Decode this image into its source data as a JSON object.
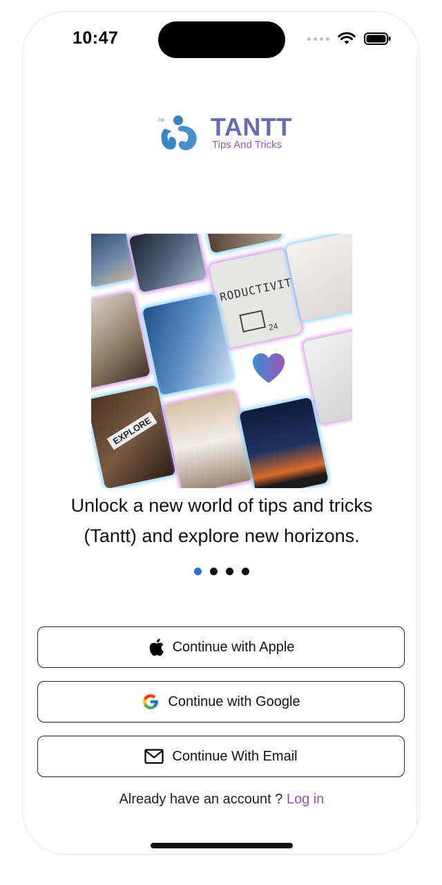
{
  "status_bar": {
    "time": "10:47",
    "icons": [
      "signal-dots-icon",
      "wifi-icon",
      "battery-icon"
    ]
  },
  "logo": {
    "name": "TANTT",
    "tagline": "Tips And Tricks",
    "tm": "TM",
    "colors": {
      "mark": "#3a84c4",
      "name": "#6b6ab4",
      "tagline": "#9a57b5"
    }
  },
  "onboarding": {
    "headline_line1": "Unlock a new world of tips and tricks",
    "headline_line2": "(Tantt) and explore new horizons.",
    "page_count": 4,
    "active_page": 1,
    "collage_image_labels": [
      "RODUCTIVITY",
      "EXPLORE",
      "24"
    ]
  },
  "auth": {
    "apple_label": "Continue with Apple",
    "google_label": "Continue with Google",
    "email_label": "Continue With Email",
    "existing_account_text": "Already have an account ?",
    "login_link": "Log in"
  },
  "colors": {
    "accent": "#9b4fb1",
    "active_dot": "#2f6fe0",
    "button_border": "#222222"
  }
}
